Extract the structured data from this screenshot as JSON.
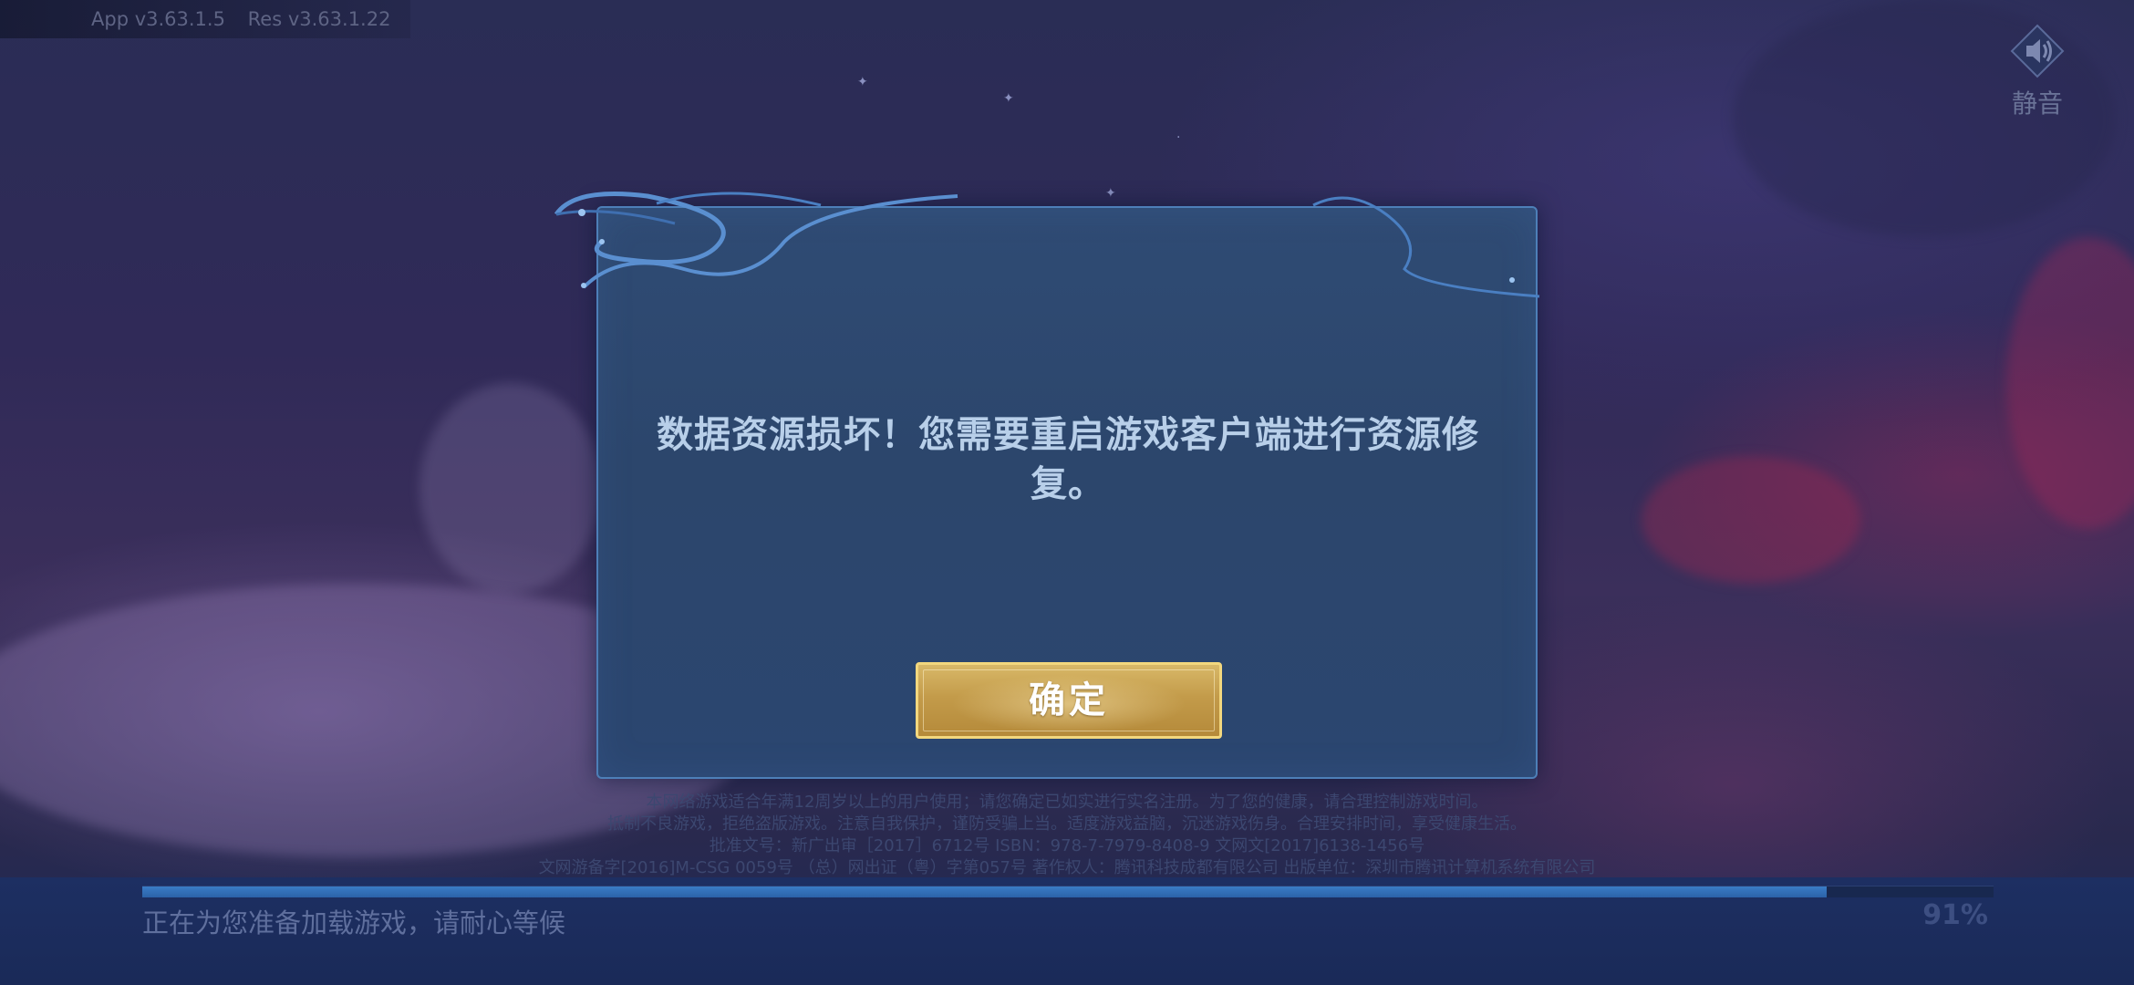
{
  "header": {
    "app_version": "App v3.63.1.5",
    "res_version": "Res v3.63.1.22"
  },
  "mute": {
    "label": "静音",
    "icon": "speaker-icon"
  },
  "dialog": {
    "message": "数据资源损坏！您需要重启游戏客户端进行资源修复。",
    "confirm_label": "确定"
  },
  "legal": {
    "line1": "本网络游戏适合年满12周岁以上的用户使用；请您确定已如实进行实名注册。为了您的健康，请合理控制游戏时间。",
    "line2": "抵制不良游戏，拒绝盗版游戏。注意自我保护，谨防受骗上当。适度游戏益脑，沉迷游戏伤身。合理安排时间，享受健康生活。",
    "line3": "批准文号：新广出审［2017］6712号 ISBN：978-7-7979-8408-9 文网文[2017]6138-1456号",
    "line4": "文网游备字[2016]M-CSG 0059号 （总）网出证（粤）字第057号 著作权人：腾讯科技成都有限公司 出版单位：深圳市腾讯计算机系统有限公司"
  },
  "loading": {
    "status_text": "正在为您准备加载游戏，请耐心等候",
    "percent_label": "91%",
    "progress": 0.91
  },
  "colors": {
    "dialog_border": "#4d7fb8",
    "button_gold": "#c39b4a",
    "progress_fill": "#3a7cc6"
  }
}
